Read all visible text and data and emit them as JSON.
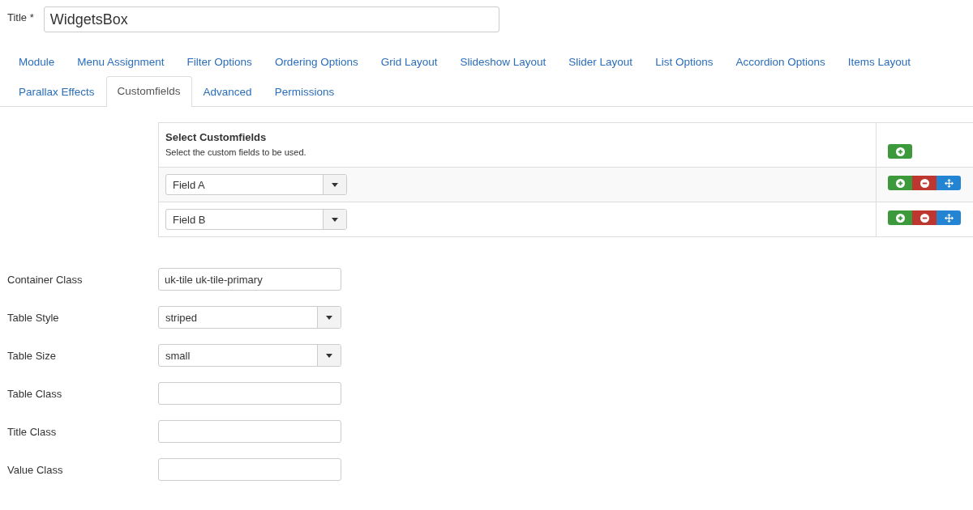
{
  "title_field": {
    "label": "Title *",
    "value": "WidgetsBox"
  },
  "tabs": [
    {
      "label": "Module",
      "selected": false
    },
    {
      "label": "Menu Assignment",
      "selected": false
    },
    {
      "label": "Filter Options",
      "selected": false
    },
    {
      "label": "Ordering Options",
      "selected": false
    },
    {
      "label": "Grid Layout",
      "selected": false
    },
    {
      "label": "Slideshow Layout",
      "selected": false
    },
    {
      "label": "Slider Layout",
      "selected": false
    },
    {
      "label": "List Options",
      "selected": false
    },
    {
      "label": "Accordion Options",
      "selected": false
    },
    {
      "label": "Items Layout",
      "selected": false
    },
    {
      "label": "Parallax Effects",
      "selected": false
    },
    {
      "label": "Customfields",
      "selected": true
    },
    {
      "label": "Advanced",
      "selected": false
    },
    {
      "label": "Permissions",
      "selected": false
    }
  ],
  "customfields": {
    "title": "Select Customfields",
    "description": "Select the custom fields to be used.",
    "rows": [
      {
        "value": "Field A"
      },
      {
        "value": "Field B"
      }
    ]
  },
  "fields": [
    {
      "label": "Container Class",
      "kind": "text",
      "value": "uk-tile uk-tile-primary"
    },
    {
      "label": "Table Style",
      "kind": "select",
      "value": "striped"
    },
    {
      "label": "Table Size",
      "kind": "select",
      "value": "small"
    },
    {
      "label": "Table Class",
      "kind": "text"
    },
    {
      "label": "Title Class",
      "kind": "text"
    },
    {
      "label": "Value Class",
      "kind": "text"
    }
  ]
}
